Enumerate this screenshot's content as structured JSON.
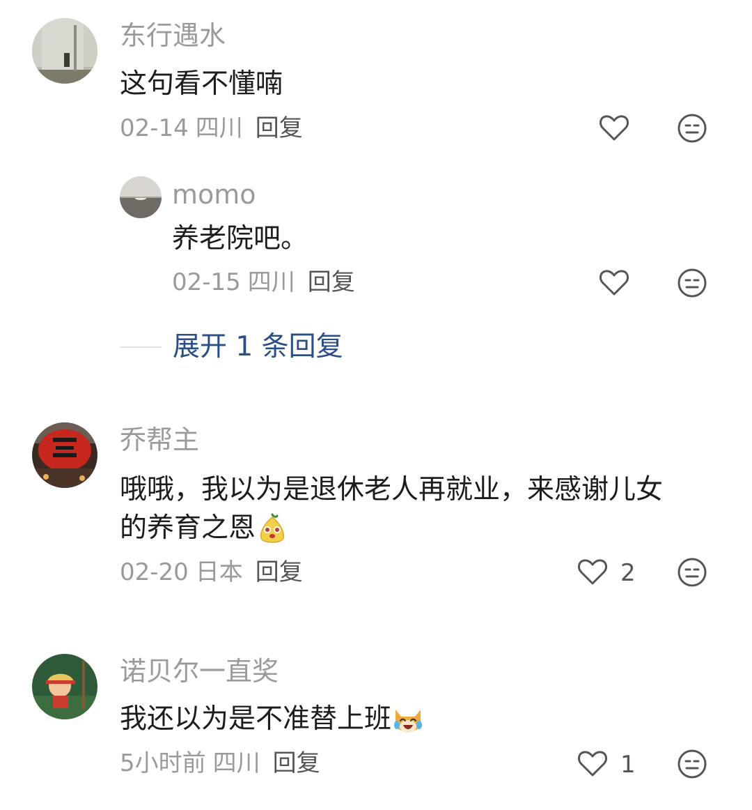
{
  "comments": [
    {
      "username": "东行遇水",
      "text": "这句看不懂喃",
      "date": "02-14",
      "location": "四川",
      "reply_label": "回复",
      "likes": "",
      "avatar_icon": "gray-wall-photo-avatar",
      "replies": [
        {
          "username": "momo",
          "text": "养老院吧。",
          "date": "02-15",
          "location": "四川",
          "reply_label": "回复",
          "likes": "",
          "avatar_icon": "sunset-photo-avatar"
        }
      ],
      "expand_label": "展开 1 条回复"
    },
    {
      "username": "乔帮主",
      "text_line1": "哦哦，我以为是退休老人再就业，来感谢儿女",
      "text_line2": "的养育之恩",
      "emoji": "cute-pear-emoji",
      "date": "02-20",
      "location": "日本",
      "reply_label": "回复",
      "likes": "2",
      "avatar_icon": "red-lantern-photo-avatar"
    },
    {
      "username": "诺贝尔一直奖",
      "text": "我还以为是不准替上班",
      "emoji": "laughing-cat-emoji",
      "date": "5小时前",
      "location": "四川",
      "reply_label": "回复",
      "likes": "1",
      "avatar_icon": "cartoon-boy-avatar"
    }
  ],
  "colors": {
    "muted": "#9a9a9a",
    "text": "#1c1c1c",
    "link": "#2a4f86",
    "icon": "#555555"
  }
}
